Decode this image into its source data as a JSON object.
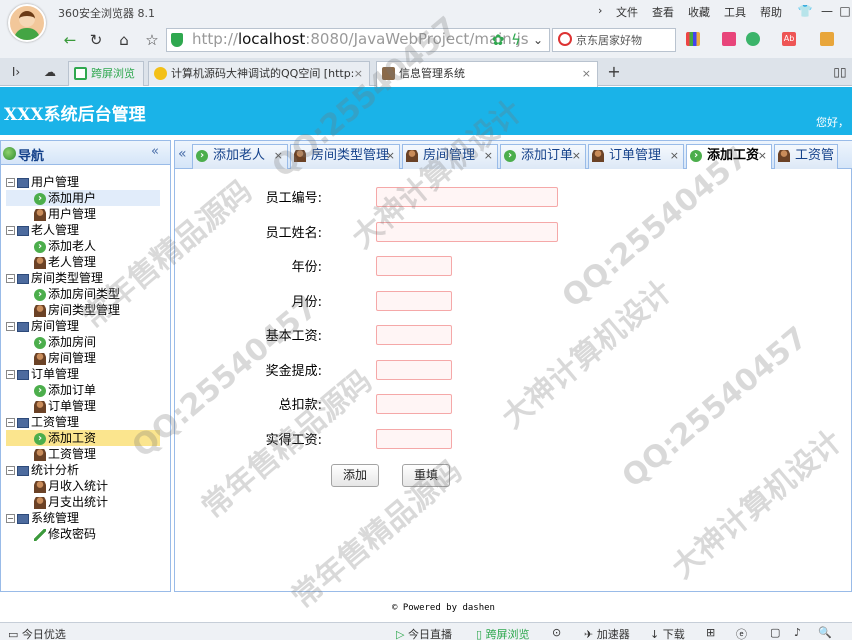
{
  "browser": {
    "title": "360安全浏览器 8.1",
    "menu": [
      "文件",
      "查看",
      "收藏",
      "工具",
      "帮助"
    ],
    "url_prefix": "http://",
    "url_host": "localhost",
    "url_rest": ":8080/JavaWebProject/main.js",
    "search_text": "京东居家好物",
    "tabs": [
      {
        "label": "跨屏浏览"
      },
      {
        "label": "计算机源码大神调试的QQ空间 [http:"
      },
      {
        "label": "信息管理系统"
      }
    ],
    "status": {
      "left": "今日优选",
      "live": "今日直播",
      "cross": "跨屏浏览",
      "accelerate": "加速器",
      "download": "下载"
    }
  },
  "app": {
    "title": "XXX系统后台管理",
    "greeting": "您好，"
  },
  "sidebar": {
    "title": "导航",
    "groups": [
      {
        "label": "用户管理",
        "items": [
          {
            "label": "添加用户",
            "icon": "add-icon"
          },
          {
            "label": "用户管理",
            "icon": "user-icon"
          }
        ]
      },
      {
        "label": "老人管理",
        "items": [
          {
            "label": "添加老人",
            "icon": "add-icon"
          },
          {
            "label": "老人管理",
            "icon": "user-icon"
          }
        ]
      },
      {
        "label": "房间类型管理",
        "items": [
          {
            "label": "添加房间类型",
            "icon": "add-icon"
          },
          {
            "label": "房间类型管理",
            "icon": "user-icon"
          }
        ]
      },
      {
        "label": "房间管理",
        "items": [
          {
            "label": "添加房间",
            "icon": "add-icon"
          },
          {
            "label": "房间管理",
            "icon": "user-icon"
          }
        ]
      },
      {
        "label": "订单管理",
        "items": [
          {
            "label": "添加订单",
            "icon": "add-icon"
          },
          {
            "label": "订单管理",
            "icon": "user-icon"
          }
        ]
      },
      {
        "label": "工资管理",
        "items": [
          {
            "label": "添加工资",
            "icon": "add-icon"
          },
          {
            "label": "工资管理",
            "icon": "user-icon"
          }
        ]
      },
      {
        "label": "统计分析",
        "items": [
          {
            "label": "月收入统计",
            "icon": "user-icon"
          },
          {
            "label": "月支出统计",
            "icon": "user-icon"
          }
        ]
      },
      {
        "label": "系统管理",
        "items": [
          {
            "label": "修改密码",
            "icon": "pen-icon"
          }
        ]
      }
    ]
  },
  "content_tabs": [
    {
      "label": "添加老人",
      "icon": "add-icon"
    },
    {
      "label": "房间类型管理",
      "icon": "user-icon"
    },
    {
      "label": "房间管理",
      "icon": "user-icon"
    },
    {
      "label": "添加订单",
      "icon": "add-icon"
    },
    {
      "label": "订单管理",
      "icon": "user-icon"
    },
    {
      "label": "添加工资",
      "icon": "add-icon",
      "active": true
    },
    {
      "label": "工资管"
    }
  ],
  "form": {
    "fields": [
      {
        "label": "员工编号:",
        "value": ""
      },
      {
        "label": "员工姓名:",
        "value": ""
      },
      {
        "label": "年份:",
        "value": ""
      },
      {
        "label": "月份:",
        "value": ""
      },
      {
        "label": "基本工资:",
        "value": ""
      },
      {
        "label": "奖金提成:",
        "value": ""
      },
      {
        "label": "总扣款:",
        "value": ""
      },
      {
        "label": "实得工资:",
        "value": ""
      }
    ],
    "submit_label": "添加",
    "reset_label": "重填"
  },
  "footer": "© Powered by dashen",
  "watermarks": [
    "大神计算机设计",
    "QQ:25540457",
    "常年售精品源码",
    "QQ:25540457",
    "大神计算机设计",
    "常年售精品源码",
    "QQ:25540457",
    "QQ:25540457",
    "大神计算机设计",
    "常年售精品源码"
  ],
  "colors": {
    "header": "#1ab3e8",
    "selected": "#fbe58e",
    "input_border": "#f5a8a8"
  }
}
